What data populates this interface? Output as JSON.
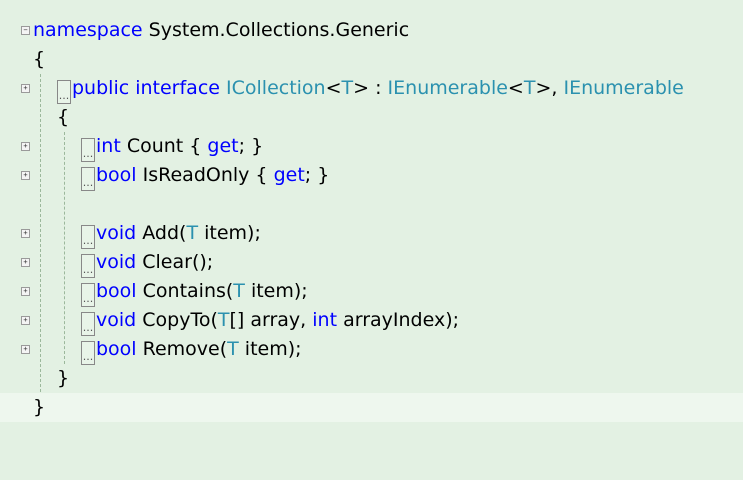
{
  "code": {
    "namespace_kw": "namespace",
    "namespace_name": " System.Collections.Generic",
    "open_brace": "{",
    "close_brace": "}",
    "ellipsis": "...",
    "interface_decl": {
      "public_kw": "public",
      "interface_kw": "interface",
      "name": "ICollection",
      "lt": "<",
      "t": "T",
      "gt": ">",
      "colon": " : ",
      "base1": "IEnumerable",
      "comma": ", ",
      "base2": "IEnumerable"
    },
    "count": {
      "type": "int",
      "rest1": " Count { ",
      "get": "get",
      "rest2": "; }"
    },
    "isreadonly": {
      "type": "bool",
      "rest1": " IsReadOnly { ",
      "get": "get",
      "rest2": "; }"
    },
    "add": {
      "ret": "void",
      "name": " Add(",
      "t": "T",
      "rest": " item);"
    },
    "clear": {
      "ret": "void",
      "name": " Clear();"
    },
    "contains": {
      "ret": "bool",
      "name": " Contains(",
      "t": "T",
      "rest": " item);"
    },
    "copyto": {
      "ret": "void",
      "name": " CopyTo(",
      "t": "T",
      "mid": "[] array, ",
      "int_kw": "int",
      "rest": " arrayIndex);"
    },
    "remove": {
      "ret": "bool",
      "name": " Remove(",
      "t": "T",
      "rest": " item);"
    }
  },
  "colors": {
    "keyword": "#0000ff",
    "type": "#2b91af",
    "background": "#e3f1e3"
  }
}
